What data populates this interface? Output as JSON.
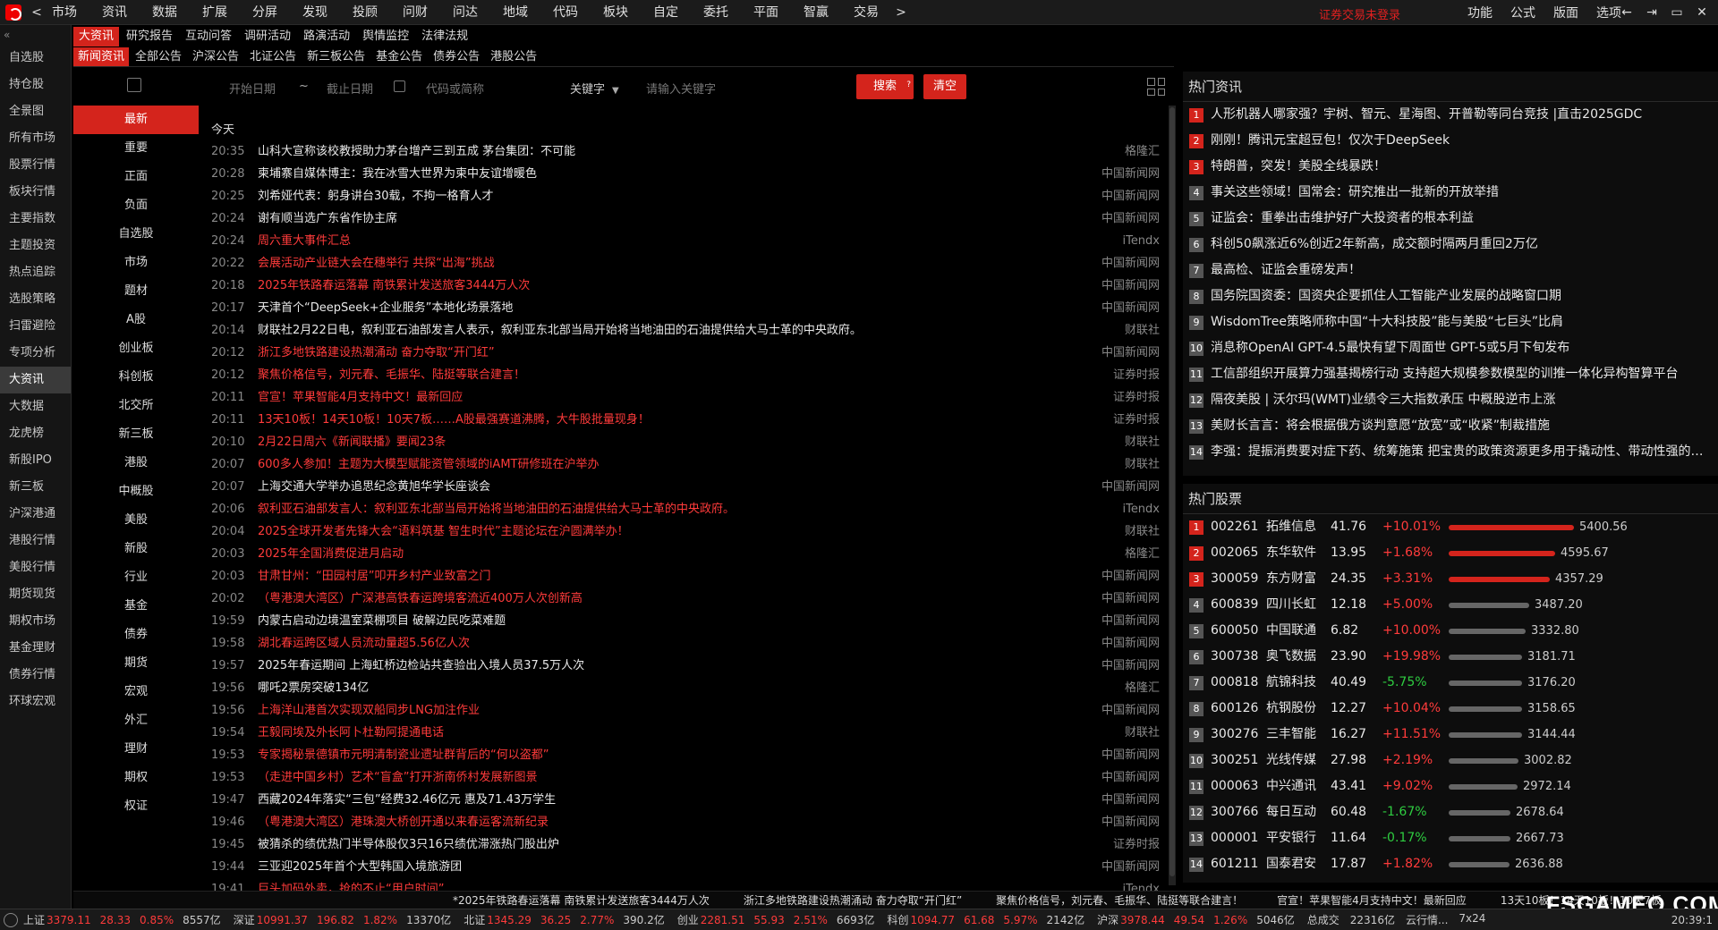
{
  "menu": {
    "back_arrow": "<",
    "items": [
      "市场",
      "资讯",
      "数据",
      "扩展",
      "分屏",
      "发现",
      "投顾",
      "问财",
      "问达",
      "地域",
      "代码",
      "板块",
      "自定",
      "委托",
      "平面",
      "智赢",
      "交易"
    ],
    "more_arrow": ">"
  },
  "login_status": "证券交易未登录",
  "right_menu": [
    "功能",
    "公式",
    "版面",
    "选项"
  ],
  "window_controls": [
    "←",
    "⇥",
    "▭",
    "✕"
  ],
  "sidebar": {
    "collapse": "«",
    "items": [
      "自选股",
      "持仓股",
      "全景图",
      "所有市场",
      "股票行情",
      "板块行情",
      "主要指数",
      "主题投资",
      "热点追踪",
      "选股策略",
      "扫雷避险",
      "专项分析",
      "大资讯",
      "大数据",
      "龙虎榜",
      "新股IPO",
      "新三板",
      "沪深港通",
      "港股行情",
      "美股行情",
      "期货现货",
      "期权市场",
      "基金理财",
      "债券行情",
      "环球宏观"
    ],
    "active_index": 12
  },
  "tabs1": {
    "items": [
      "大资讯",
      "研究报告",
      "互动问答",
      "调研活动",
      "路演活动",
      "舆情监控",
      "法律法规"
    ],
    "active_index": 0
  },
  "tabs2": {
    "items": [
      "新闻资讯",
      "全部公告",
      "沪深公告",
      "北证公告",
      "新三板公告",
      "基金公告",
      "债券公告",
      "港股公告"
    ],
    "active_index": 0
  },
  "filter": {
    "start_date": "开始日期",
    "tilde": "~",
    "end_date": "截止日期",
    "code_placeholder": "代码或简称",
    "keyword_select": "关键字",
    "keyword_placeholder": "请输入关键字",
    "search_label": "搜索",
    "search_badge": "?",
    "clear_label": "清空"
  },
  "categories": {
    "items": [
      "最新",
      "重要",
      "正面",
      "负面",
      "自选股",
      "市场",
      "题材",
      "A股",
      "创业板",
      "科创板",
      "北交所",
      "新三板",
      "港股",
      "中概股",
      "美股",
      "新股",
      "行业",
      "基金",
      "债券",
      "期货",
      "宏观",
      "外汇",
      "理财",
      "期权",
      "权证"
    ],
    "active_index": 0
  },
  "news": {
    "day_label": "今天",
    "rows": [
      {
        "time": "20:35",
        "title": "山科大宣称该校教授助力茅台增产三到五成 茅台集团：不可能",
        "src": "格隆汇",
        "red": false
      },
      {
        "time": "20:28",
        "title": "柬埔寨自媒体博主：我在冰雪大世界为柬中友谊增暖色",
        "src": "中国新闻网",
        "red": false
      },
      {
        "time": "20:25",
        "title": "刘希娅代表：躬身讲台30载，不拘一格育人才",
        "src": "中国新闻网",
        "red": false
      },
      {
        "time": "20:24",
        "title": "谢有顺当选广东省作协主席",
        "src": "中国新闻网",
        "red": false
      },
      {
        "time": "20:24",
        "title": "周六重大事件汇总",
        "src": "iTendx",
        "red": true
      },
      {
        "time": "20:22",
        "title": "会展活动产业链大会在穗举行 共探“出海”挑战",
        "src": "中国新闻网",
        "red": true
      },
      {
        "time": "20:18",
        "title": "2025年铁路春运落幕 南铁累计发送旅客3444万人次",
        "src": "中国新闻网",
        "red": true
      },
      {
        "time": "20:17",
        "title": "天津首个“DeepSeek+企业服务”本地化场景落地",
        "src": "中国新闻网",
        "red": false
      },
      {
        "time": "20:14",
        "title": "财联社2月22日电，叙利亚石油部发言人表示，叙利亚东北部当局开始将当地油田的石油提供给大马士革的中央政府。",
        "src": "财联社",
        "red": false
      },
      {
        "time": "20:12",
        "title": "浙江多地铁路建设热潮涌动 奋力夺取“开门红”",
        "src": "中国新闻网",
        "red": true
      },
      {
        "time": "20:12",
        "title": "聚焦价格信号，刘元春、毛振华、陆挺等联合建言！",
        "src": "证券时报",
        "red": true
      },
      {
        "time": "20:11",
        "title": "官宣！苹果智能4月支持中文！最新回应",
        "src": "证券时报",
        "red": true
      },
      {
        "time": "20:11",
        "title": "13天10板！14天10板！10天7板……A股最强赛道沸腾，大牛股批量现身！",
        "src": "证券时报",
        "red": true
      },
      {
        "time": "20:10",
        "title": "2月22日周六《新闻联播》要闻23条",
        "src": "财联社",
        "red": true
      },
      {
        "time": "20:07",
        "title": "600多人参加！主题为大模型赋能资管领域的iAMT研修班在沪举办",
        "src": "财联社",
        "red": true
      },
      {
        "time": "20:07",
        "title": "上海交通大学举办追思纪念黄旭华学长座谈会",
        "src": "中国新闻网",
        "red": false
      },
      {
        "time": "20:06",
        "title": "叙利亚石油部发言人：叙利亚东北部当局开始将当地油田的石油提供给大马士革的中央政府。",
        "src": "iTendx",
        "red": true
      },
      {
        "time": "20:04",
        "title": "2025全球开发者先锋大会“语料筑基 智生时代”主题论坛在沪圆满举办！",
        "src": "财联社",
        "red": true
      },
      {
        "time": "20:03",
        "title": "2025年全国消费促进月启动",
        "src": "格隆汇",
        "red": true
      },
      {
        "time": "20:03",
        "title": "甘肃甘州：“田园村居”叩开乡村产业致富之门",
        "src": "中国新闻网",
        "red": true
      },
      {
        "time": "20:02",
        "title": "（粤港澳大湾区）广深港高铁春运跨境客流近400万人次创新高",
        "src": "中国新闻网",
        "red": true
      },
      {
        "time": "19:59",
        "title": "内蒙古启动边境温室菜棚项目 破解边民吃菜难题",
        "src": "中国新闻网",
        "red": false
      },
      {
        "time": "19:58",
        "title": "湖北春运跨区域人员流动量超5.56亿人次",
        "src": "中国新闻网",
        "red": true
      },
      {
        "time": "19:57",
        "title": "2025年春运期间 上海虹桥边检站共查验出入境人员37.5万人次",
        "src": "中国新闻网",
        "red": false
      },
      {
        "time": "19:56",
        "title": "哪吒2票房突破134亿",
        "src": "格隆汇",
        "red": false
      },
      {
        "time": "19:56",
        "title": "上海洋山港首次实现双船同步LNG加注作业",
        "src": "中国新闻网",
        "red": true
      },
      {
        "time": "19:54",
        "title": "王毅同埃及外长阿卜杜勒阿提通电话",
        "src": "财联社",
        "red": true
      },
      {
        "time": "19:53",
        "title": "专家揭秘景德镇市元明清制瓷业遗址群背后的“何以盗都”",
        "src": "中国新闻网",
        "red": true
      },
      {
        "time": "19:53",
        "title": "（走进中国乡村）艺术“盲盒”打开浙南侨村发展新图景",
        "src": "中国新闻网",
        "red": true
      },
      {
        "time": "19:47",
        "title": "西藏2024年落实“三包”经费32.46亿元 惠及71.43万学生",
        "src": "中国新闻网",
        "red": false
      },
      {
        "time": "19:46",
        "title": "（粤港澳大湾区）港珠澳大桥创开通以来春运客流新纪录",
        "src": "中国新闻网",
        "red": true
      },
      {
        "time": "19:45",
        "title": "被猜杀的绩优热门半导体股仅3只16只绩优滞涨热门股出炉",
        "src": "证券时报",
        "red": false
      },
      {
        "time": "19:44",
        "title": "三亚迎2025年首个大型韩国入境旅游团",
        "src": "中国新闻网",
        "red": false
      },
      {
        "time": "19:41",
        "title": "巨头加码外卖，抢的不止“用户时间”",
        "src": "iTendx",
        "red": true
      }
    ]
  },
  "hot_news": {
    "title": "热门资讯",
    "items": [
      "人形机器人哪家强？宇树、智元、星海图、开普勒等同台竞技 |直击2025GDC",
      "刚刚！腾讯元宝超豆包！仅次于DeepSeek",
      "特朗普，突发！美股全线暴跌！",
      "事关这些领域！国常会：研究推出一批新的开放举措",
      "证监会：重拳出击维护好广大投资者的根本利益",
      "科创50飙涨近6%创近2年新高，成交额时隔两月重回2万亿",
      "最高检、证监会重磅发声！",
      "国务院国资委：国资央企要抓住人工智能产业发展的战略窗口期",
      "WisdomTree策略师称中国“十大科技股”能与美股“七巨头”比肩",
      "消息称OpenAI GPT-4.5最快有望下周面世 GPT-5或5月下旬发布",
      "工信部组织开展算力强基揭榜行动 支持超大规模参数模型的训推一体化异构智算平台",
      "隔夜美股 | 沃尔玛(WMT)业绩令三大指数承压 中概股逆市上涨",
      "美财长言言：将会根据俄方谈判意愿“放宽”或“收紧”制裁措施",
      "李强：提振消费要对症下药、统筹施策 把宝贵的政策资源更多用于撬动性、带动性强的…"
    ]
  },
  "hot_stocks": {
    "title": "热门股票",
    "items": [
      {
        "code": "002261",
        "name": "拓维信息",
        "price": "41.76",
        "chg": "+10.01%",
        "up": true,
        "vol": "5400.56",
        "heat": 5400.56
      },
      {
        "code": "002065",
        "name": "东华软件",
        "price": "13.95",
        "chg": "+1.68%",
        "up": true,
        "vol": "4595.67",
        "heat": 4595.67
      },
      {
        "code": "300059",
        "name": "东方财富",
        "price": "24.35",
        "chg": "+3.31%",
        "up": true,
        "vol": "4357.29",
        "heat": 4357.29
      },
      {
        "code": "600839",
        "name": "四川长虹",
        "price": "12.18",
        "chg": "+5.00%",
        "up": true,
        "vol": "3487.20",
        "heat": 3487.2
      },
      {
        "code": "600050",
        "name": "中国联通",
        "price": "6.82",
        "chg": "+10.00%",
        "up": true,
        "vol": "3332.80",
        "heat": 3332.8
      },
      {
        "code": "300738",
        "name": "奥飞数据",
        "price": "23.90",
        "chg": "+19.98%",
        "up": true,
        "vol": "3181.71",
        "heat": 3181.71
      },
      {
        "code": "000818",
        "name": "航锦科技",
        "price": "40.49",
        "chg": "-5.75%",
        "up": false,
        "vol": "3176.20",
        "heat": 3176.2
      },
      {
        "code": "600126",
        "name": "杭钢股份",
        "price": "12.27",
        "chg": "+10.04%",
        "up": true,
        "vol": "3158.65",
        "heat": 3158.65
      },
      {
        "code": "300276",
        "name": "三丰智能",
        "price": "16.27",
        "chg": "+11.51%",
        "up": true,
        "vol": "3144.44",
        "heat": 3144.44
      },
      {
        "code": "300251",
        "name": "光线传媒",
        "price": "27.98",
        "chg": "+2.19%",
        "up": true,
        "vol": "3002.82",
        "heat": 3002.82
      },
      {
        "code": "000063",
        "name": "中兴通讯",
        "price": "43.41",
        "chg": "+9.02%",
        "up": true,
        "vol": "2972.14",
        "heat": 2972.14
      },
      {
        "code": "300766",
        "name": "每日互动",
        "price": "60.48",
        "chg": "-1.67%",
        "up": false,
        "vol": "2678.64",
        "heat": 2678.64
      },
      {
        "code": "000001",
        "name": "平安银行",
        "price": "11.64",
        "chg": "-0.17%",
        "up": false,
        "vol": "2667.73",
        "heat": 2667.73
      },
      {
        "code": "601211",
        "name": "国泰君安",
        "price": "17.87",
        "chg": "+1.82%",
        "up": true,
        "vol": "2636.88",
        "heat": 2636.88
      }
    ]
  },
  "ticker": [
    "*2025年铁路春运落幕 南铁累计发送旅客3444万人次",
    "浙江多地铁路建设热潮涌动 奋力夺取“开门红”",
    "聚焦价格信号，刘元春、毛振华、陆挺等联合建言！",
    "官宣！苹果智能4月支持中文！最新回应",
    "13天10板！14天10板！10天7板"
  ],
  "watermark": "FSGAMEO.COM",
  "index_bar": {
    "indices": [
      {
        "name": "上证",
        "value": "3379.11",
        "chg": "28.33",
        "pct": "0.85%",
        "amt": "8557亿"
      },
      {
        "name": "深证",
        "value": "10991.37",
        "chg": "196.82",
        "pct": "1.82%",
        "amt": "13370亿"
      },
      {
        "name": "北证",
        "value": "1345.29",
        "chg": "36.25",
        "pct": "2.77%",
        "amt": "390.2亿"
      },
      {
        "name": "创业",
        "value": "2281.51",
        "chg": "55.93",
        "pct": "2.51%",
        "amt": "6693亿"
      },
      {
        "name": "科创",
        "value": "1094.77",
        "chg": "61.68",
        "pct": "5.97%",
        "amt": "2142亿"
      },
      {
        "name": "沪深",
        "value": "3978.44",
        "chg": "49.54",
        "pct": "1.26%",
        "amt": "5046亿"
      }
    ],
    "misc": [
      "总成交",
      "22316亿",
      "云行情...",
      "7x24"
    ],
    "clock": "20:39:1"
  },
  "colors": {
    "accent": "#d4241c",
    "up": "#ff3b3b",
    "down": "#2ecc40"
  }
}
